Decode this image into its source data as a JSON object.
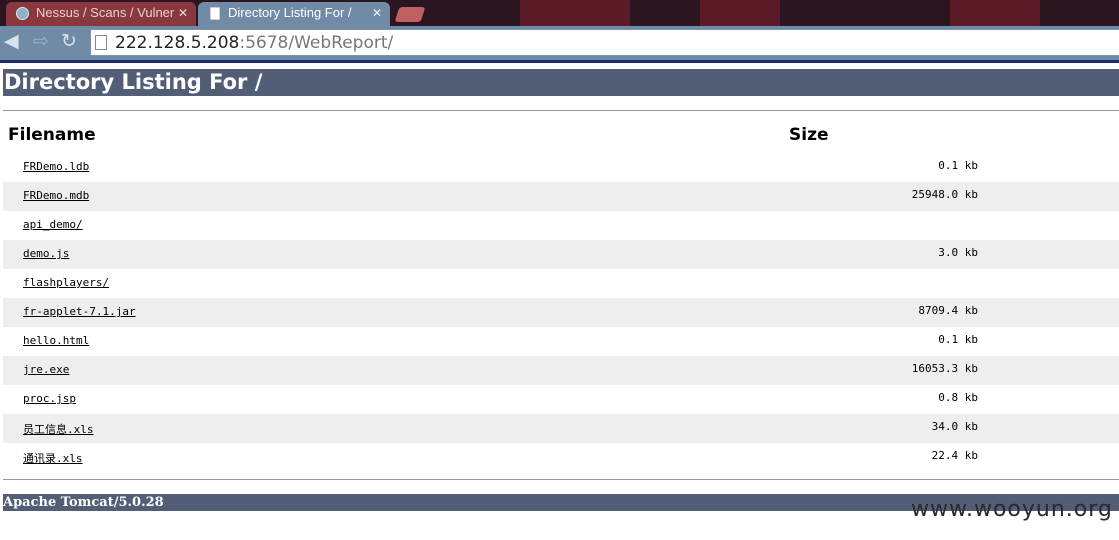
{
  "browser": {
    "tabs": [
      {
        "title": "Nessus / Scans / Vulner",
        "icon": "nessus-icon",
        "active": false
      },
      {
        "title": "Directory Listing For /",
        "icon": "page-icon",
        "active": true
      }
    ],
    "address_host": "222.128.5.208",
    "address_rest": ":5678/WebReport/"
  },
  "page": {
    "heading": "Directory Listing For /",
    "col_filename": "Filename",
    "col_size": "Size",
    "files": [
      {
        "name": "FRDemo.ldb",
        "size": "0.1 kb"
      },
      {
        "name": "FRDemo.mdb",
        "size": "25948.0 kb"
      },
      {
        "name": "api_demo/",
        "size": ""
      },
      {
        "name": "demo.js",
        "size": "3.0 kb"
      },
      {
        "name": "flashplayers/",
        "size": ""
      },
      {
        "name": "fr-applet-7.1.jar",
        "size": "8709.4 kb"
      },
      {
        "name": "hello.html",
        "size": "0.1 kb"
      },
      {
        "name": "jre.exe",
        "size": "16053.3 kb"
      },
      {
        "name": "proc.jsp",
        "size": "0.8 kb"
      },
      {
        "name": "员工信息.xls",
        "size": "34.0 kb"
      },
      {
        "name": "通讯录.xls",
        "size": "22.4 kb"
      }
    ],
    "footer": "Apache Tomcat/5.0.28"
  },
  "watermark": "www.wooyun.org",
  "colors": {
    "header_bar": "#525d76",
    "alt_row": "#eeeeee",
    "toolbar": "#6f8ba6"
  }
}
